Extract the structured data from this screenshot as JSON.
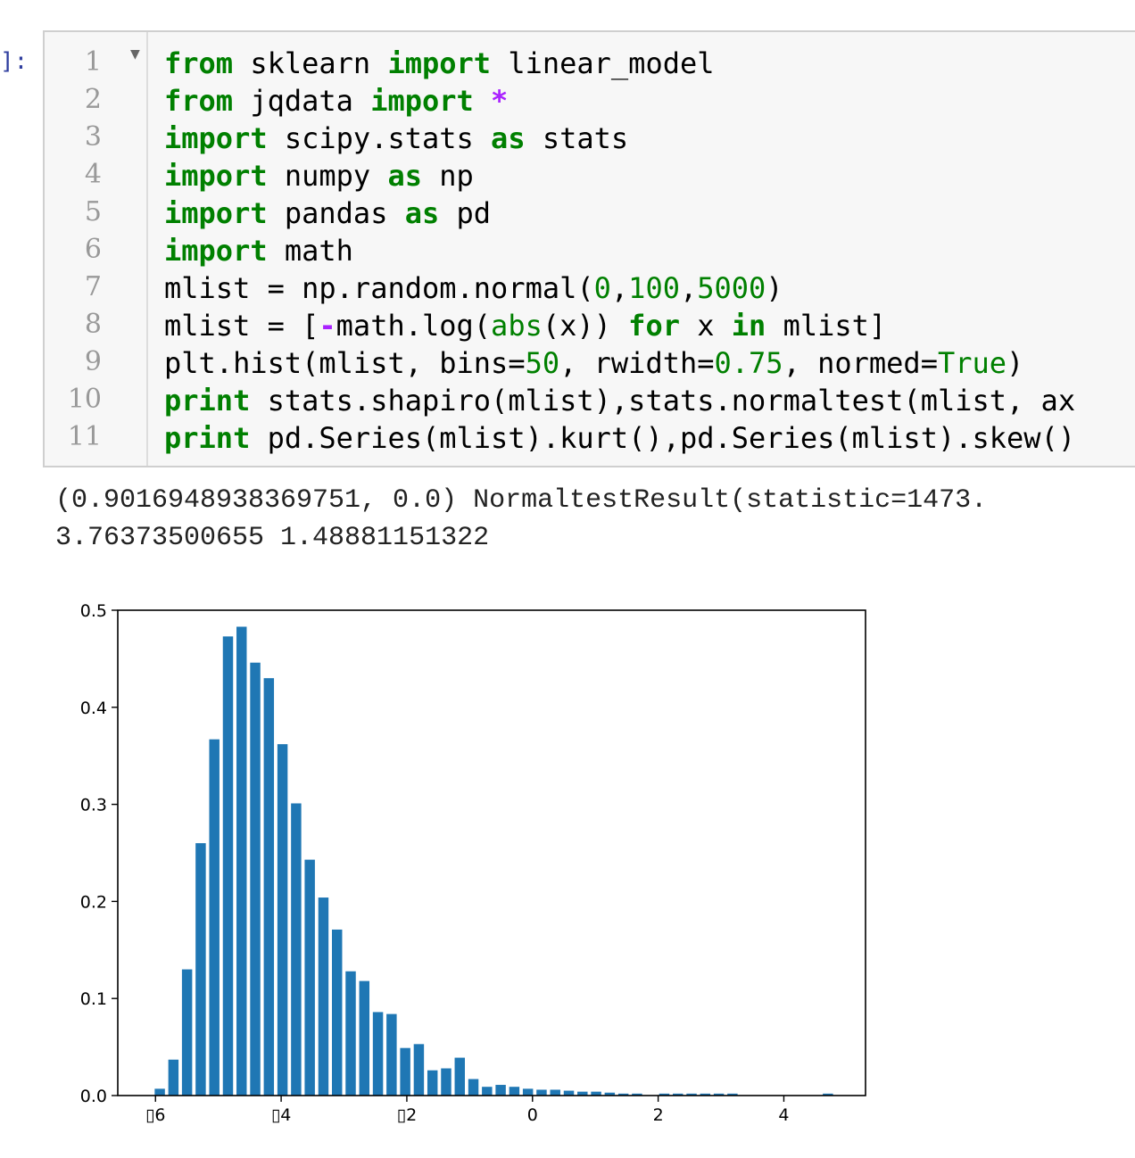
{
  "cell": {
    "prompt": "]:",
    "line_numbers": [
      "1",
      "2",
      "3",
      "4",
      "5",
      "6",
      "7",
      "8",
      "9",
      "10",
      "11"
    ],
    "code_lines": [
      [
        {
          "t": "from",
          "c": "kw"
        },
        {
          "t": " sklearn "
        },
        {
          "t": "import",
          "c": "kw"
        },
        {
          "t": " linear_model"
        }
      ],
      [
        {
          "t": "from",
          "c": "kw"
        },
        {
          "t": " jqdata "
        },
        {
          "t": "import",
          "c": "kw"
        },
        {
          "t": " "
        },
        {
          "t": "*",
          "c": "op"
        }
      ],
      [
        {
          "t": "import",
          "c": "kw"
        },
        {
          "t": " scipy.stats "
        },
        {
          "t": "as",
          "c": "kw"
        },
        {
          "t": " stats"
        }
      ],
      [
        {
          "t": "import",
          "c": "kw"
        },
        {
          "t": " numpy "
        },
        {
          "t": "as",
          "c": "kw"
        },
        {
          "t": " np"
        }
      ],
      [
        {
          "t": "import",
          "c": "kw"
        },
        {
          "t": " pandas "
        },
        {
          "t": "as",
          "c": "kw"
        },
        {
          "t": " pd"
        }
      ],
      [
        {
          "t": "import",
          "c": "kw"
        },
        {
          "t": " math"
        }
      ],
      [
        {
          "t": "mlist = np.random.normal("
        },
        {
          "t": "0",
          "c": "num"
        },
        {
          "t": ","
        },
        {
          "t": "100",
          "c": "num"
        },
        {
          "t": ","
        },
        {
          "t": "5000",
          "c": "num"
        },
        {
          "t": ")"
        }
      ],
      [
        {
          "t": "mlist = ["
        },
        {
          "t": "-",
          "c": "op"
        },
        {
          "t": "math.log("
        },
        {
          "t": "abs",
          "c": "builtin"
        },
        {
          "t": "(x)) "
        },
        {
          "t": "for",
          "c": "kw"
        },
        {
          "t": " x "
        },
        {
          "t": "in",
          "c": "kw"
        },
        {
          "t": " mlist]"
        }
      ],
      [
        {
          "t": "plt.hist(mlist, bins="
        },
        {
          "t": "50",
          "c": "num"
        },
        {
          "t": ", rwidth="
        },
        {
          "t": "0.75",
          "c": "num"
        },
        {
          "t": ", normed="
        },
        {
          "t": "True",
          "c": "builtin"
        },
        {
          "t": ")"
        }
      ],
      [
        {
          "t": "print",
          "c": "kw"
        },
        {
          "t": " stats.shapiro(mlist),stats.normaltest(mlist, ax"
        }
      ],
      [
        {
          "t": "print",
          "c": "kw"
        },
        {
          "t": " pd.Series(mlist).kurt(),pd.Series(mlist).skew()"
        }
      ]
    ]
  },
  "output": {
    "line1": "(0.9016948938369751, 0.0) NormaltestResult(statistic=1473.",
    "line2": "3.76373500655 1.48881151322"
  },
  "chart_data": {
    "type": "bar",
    "title": "",
    "xlabel": "",
    "ylabel": "",
    "xlim": [
      -6.6,
      5.3
    ],
    "ylim": [
      0,
      0.5
    ],
    "xticks": [
      -6,
      -4,
      -2,
      0,
      2,
      4
    ],
    "xtick_labels": [
      "▯6",
      "▯4",
      "▯2",
      "0",
      "2",
      "4"
    ],
    "yticks": [
      0.0,
      0.1,
      0.2,
      0.3,
      0.4,
      0.5
    ],
    "ytick_labels": [
      "0.0",
      "0.1",
      "0.2",
      "0.3",
      "0.4",
      "0.5"
    ],
    "bar_color": "#1f77b4",
    "bin_start": -6.04,
    "bin_width": 0.217,
    "bar_fraction": 0.75,
    "values": [
      0.007,
      0.037,
      0.13,
      0.26,
      0.367,
      0.473,
      0.483,
      0.446,
      0.43,
      0.362,
      0.301,
      0.243,
      0.204,
      0.171,
      0.128,
      0.118,
      0.086,
      0.084,
      0.049,
      0.053,
      0.026,
      0.028,
      0.039,
      0.017,
      0.009,
      0.011,
      0.009,
      0.007,
      0.006,
      0.006,
      0.005,
      0.004,
      0.004,
      0.003,
      0.002,
      0.002,
      0.0,
      0.002,
      0.002,
      0.002,
      0.002,
      0.002,
      0.002,
      0.0,
      0.0,
      0.0,
      0.0,
      0.0,
      0.0,
      0.002
    ]
  }
}
